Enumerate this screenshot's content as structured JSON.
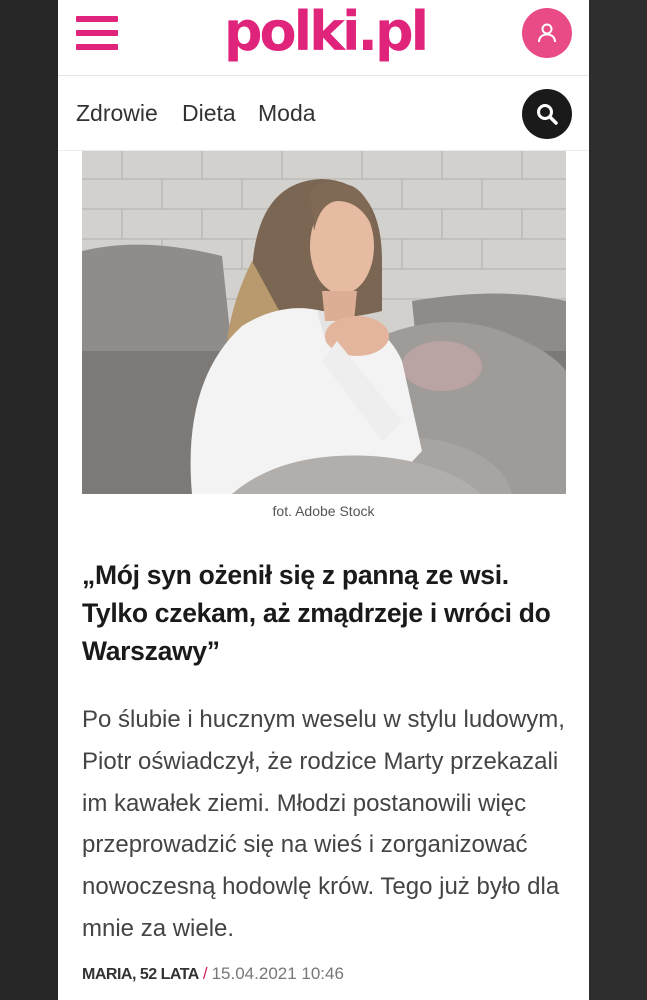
{
  "header": {
    "logo": "polki.pl"
  },
  "nav": {
    "items": [
      "Zdrowie",
      "Dieta",
      "Moda"
    ]
  },
  "article": {
    "photo_caption": "fot. Adobe Stock",
    "title": "„Mój syn ożenił się z panną ze wsi. Tylko czekam, aż zmądrzeje i wróci do Warszawy”",
    "lead": "Po ślubie i hucznym weselu w stylu ludowym, Piotr oświadczył, że rodzice Marty przekazali im kawałek ziemi. Młodzi postanowili więc przeprowadzić się na wieś i zorganizować nowoczesną hodowlę krów. Tego już było dla mnie za wiele.",
    "author": "MARIA, 52 LATA",
    "separator": "/",
    "date": "15.04.2021 10:46"
  },
  "colors": {
    "brand": "#e0237b",
    "user_button": "#e94b86",
    "search_button": "#1a1a1a"
  },
  "icons": {
    "menu": "hamburger-icon",
    "user": "user-icon",
    "search": "search-icon"
  }
}
